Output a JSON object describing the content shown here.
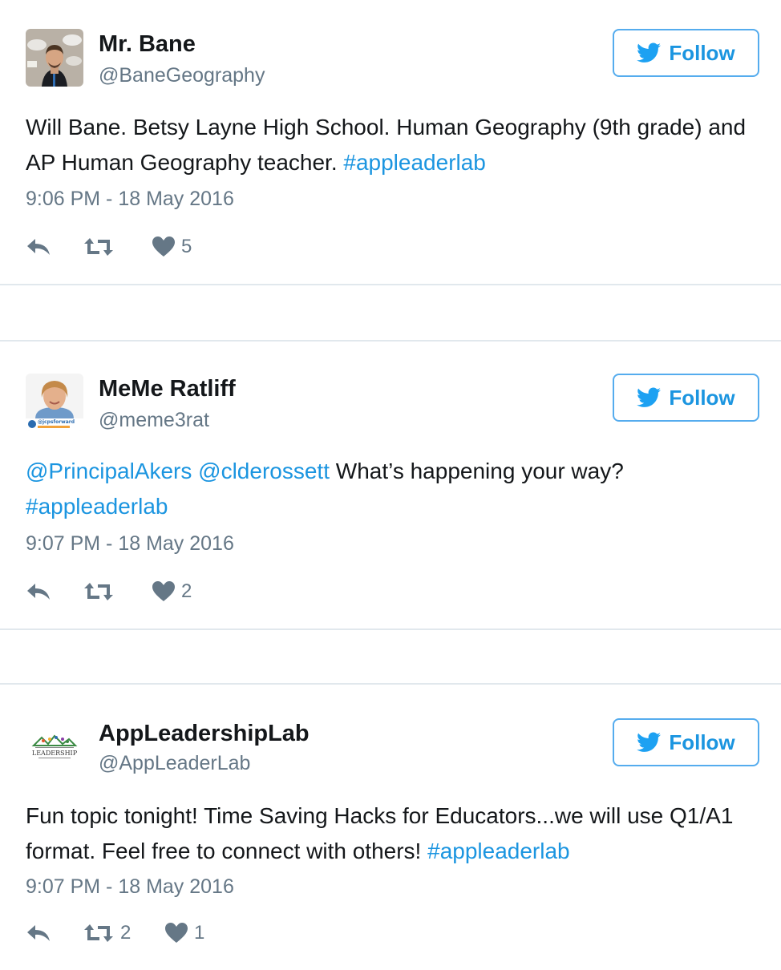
{
  "colors": {
    "link": "#1b95e0",
    "follow_border": "#55acee",
    "muted": "#657786",
    "divider": "#e1e8ed"
  },
  "tweets": [
    {
      "name": "Mr. Bane",
      "handle": "@BaneGeography",
      "follow_label": "Follow",
      "text_segments": [
        {
          "text": "Will Bane. Betsy Layne High School. Human Geography (9th grade) and AP Human Geography teacher. ",
          "link": false
        },
        {
          "text": "#appleaderlab",
          "link": true
        }
      ],
      "timestamp": "9:06 PM - 18 May 2016",
      "retweets": "",
      "likes": "5",
      "avatar": "person-photo-icon"
    },
    {
      "name": "MeMe Ratliff",
      "handle": "@meme3rat",
      "follow_label": "Follow",
      "text_segments": [
        {
          "text": "@PrincipalAkers",
          "link": true
        },
        {
          "text": " ",
          "link": false
        },
        {
          "text": "@clderossett",
          "link": true
        },
        {
          "text": " What’s happening your way? ",
          "link": false
        },
        {
          "text": "#appleaderlab",
          "link": true
        }
      ],
      "timestamp": "9:07 PM - 18 May 2016",
      "retweets": "",
      "likes": "2",
      "avatar": "person-photo-icon",
      "avatar_badge": "@jcpsforward"
    },
    {
      "name": "AppLeadershipLab",
      "handle": "@AppLeaderLab",
      "follow_label": "Follow",
      "text_segments": [
        {
          "text": "Fun topic tonight! Time Saving Hacks for Educators...we will use Q1/A1 format. Feel free to connect with others! ",
          "link": false
        },
        {
          "text": "#appleaderlab",
          "link": true
        }
      ],
      "timestamp": "9:07 PM - 18 May 2016",
      "retweets": "2",
      "likes": "1",
      "avatar": "leadership-logo-icon",
      "avatar_logo_text": "LEADERSHIP"
    }
  ]
}
